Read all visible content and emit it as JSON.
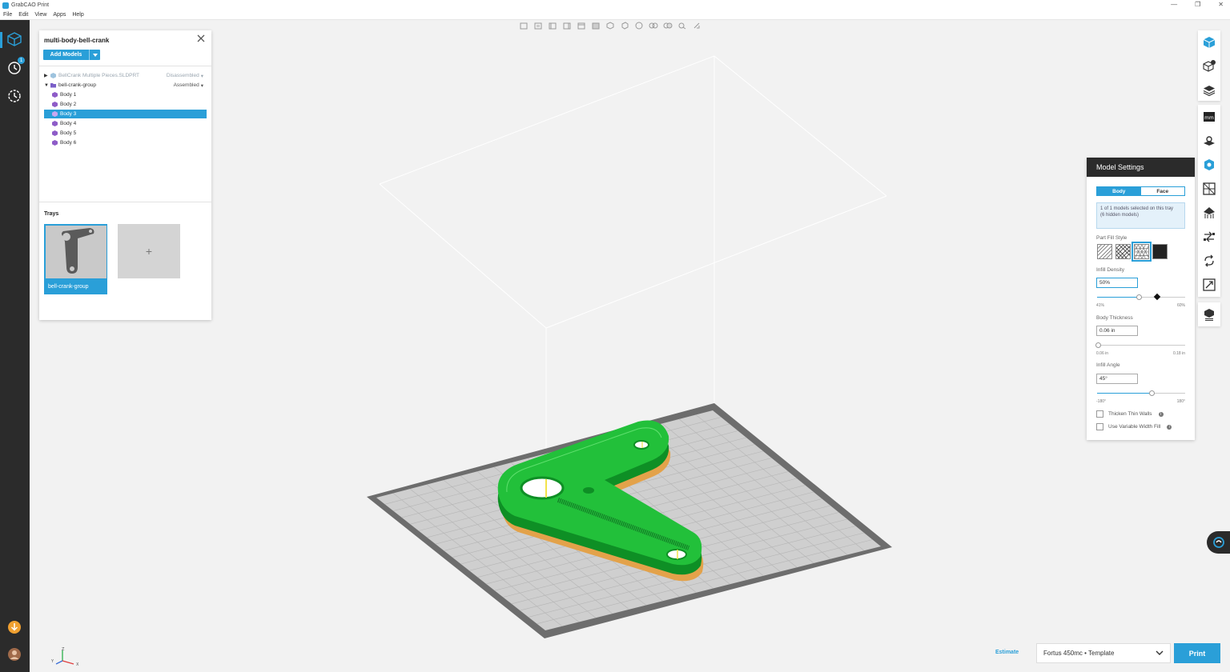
{
  "app": {
    "title": "GrabCAO Print"
  },
  "menu": [
    "File",
    "Edit",
    "View",
    "Apps",
    "Help"
  ],
  "window_controls": [
    "—",
    "❐",
    "✕"
  ],
  "left_rail": {
    "history_badge": "1"
  },
  "model_panel": {
    "title": "multi-body-bell-crank",
    "add_models_label": "Add Models",
    "tree": [
      {
        "label": "BellCrank Multiple Pieces.SLDPRT",
        "status": "Disassembled",
        "level": 0,
        "expanded": false,
        "faded": true
      },
      {
        "label": "bell-crank-group",
        "status": "Assembled",
        "level": 0,
        "expanded": true,
        "faded": false
      },
      {
        "label": "Body 1",
        "level": 1
      },
      {
        "label": "Body 2",
        "level": 1
      },
      {
        "label": "Body 3",
        "level": 1,
        "selected": true
      },
      {
        "label": "Body 4",
        "level": 1
      },
      {
        "label": "Body 5",
        "level": 1
      },
      {
        "label": "Body 6",
        "level": 1
      }
    ],
    "trays_title": "Trays",
    "tray_name": "bell-crank-group",
    "add_tray_label": "+"
  },
  "model_settings": {
    "title": "Model Settings",
    "tabs": [
      "Body",
      "Face"
    ],
    "active_tab": "Body",
    "info_line1": "1 of 1 models selected on this tray",
    "info_line2": "(6 hidden models)",
    "part_fill_label": "Part Fill Style",
    "infill_density_label": "Infill Density",
    "infill_density_value": "50%",
    "infill_min": "41%",
    "infill_max": "60%",
    "body_thickness_label": "Body Thickness",
    "body_thickness_value": "0.06 in",
    "thickness_min": "0.06 in",
    "thickness_max": "0.18 in",
    "infill_angle_label": "Infill Angle",
    "infill_angle_value": "45°",
    "angle_min": "-180°",
    "angle_max": "180°",
    "thicken_label": "Thicken Thin Walls",
    "variable_label": "Use Variable Width Fill"
  },
  "bottom": {
    "estimate_label": "Estimate",
    "printer": "Fortus 450mc • Template",
    "print_label": "Print"
  },
  "colors": {
    "accent": "#2a9fd8",
    "model": "#22c03a",
    "rail": "#2b2b2b"
  }
}
